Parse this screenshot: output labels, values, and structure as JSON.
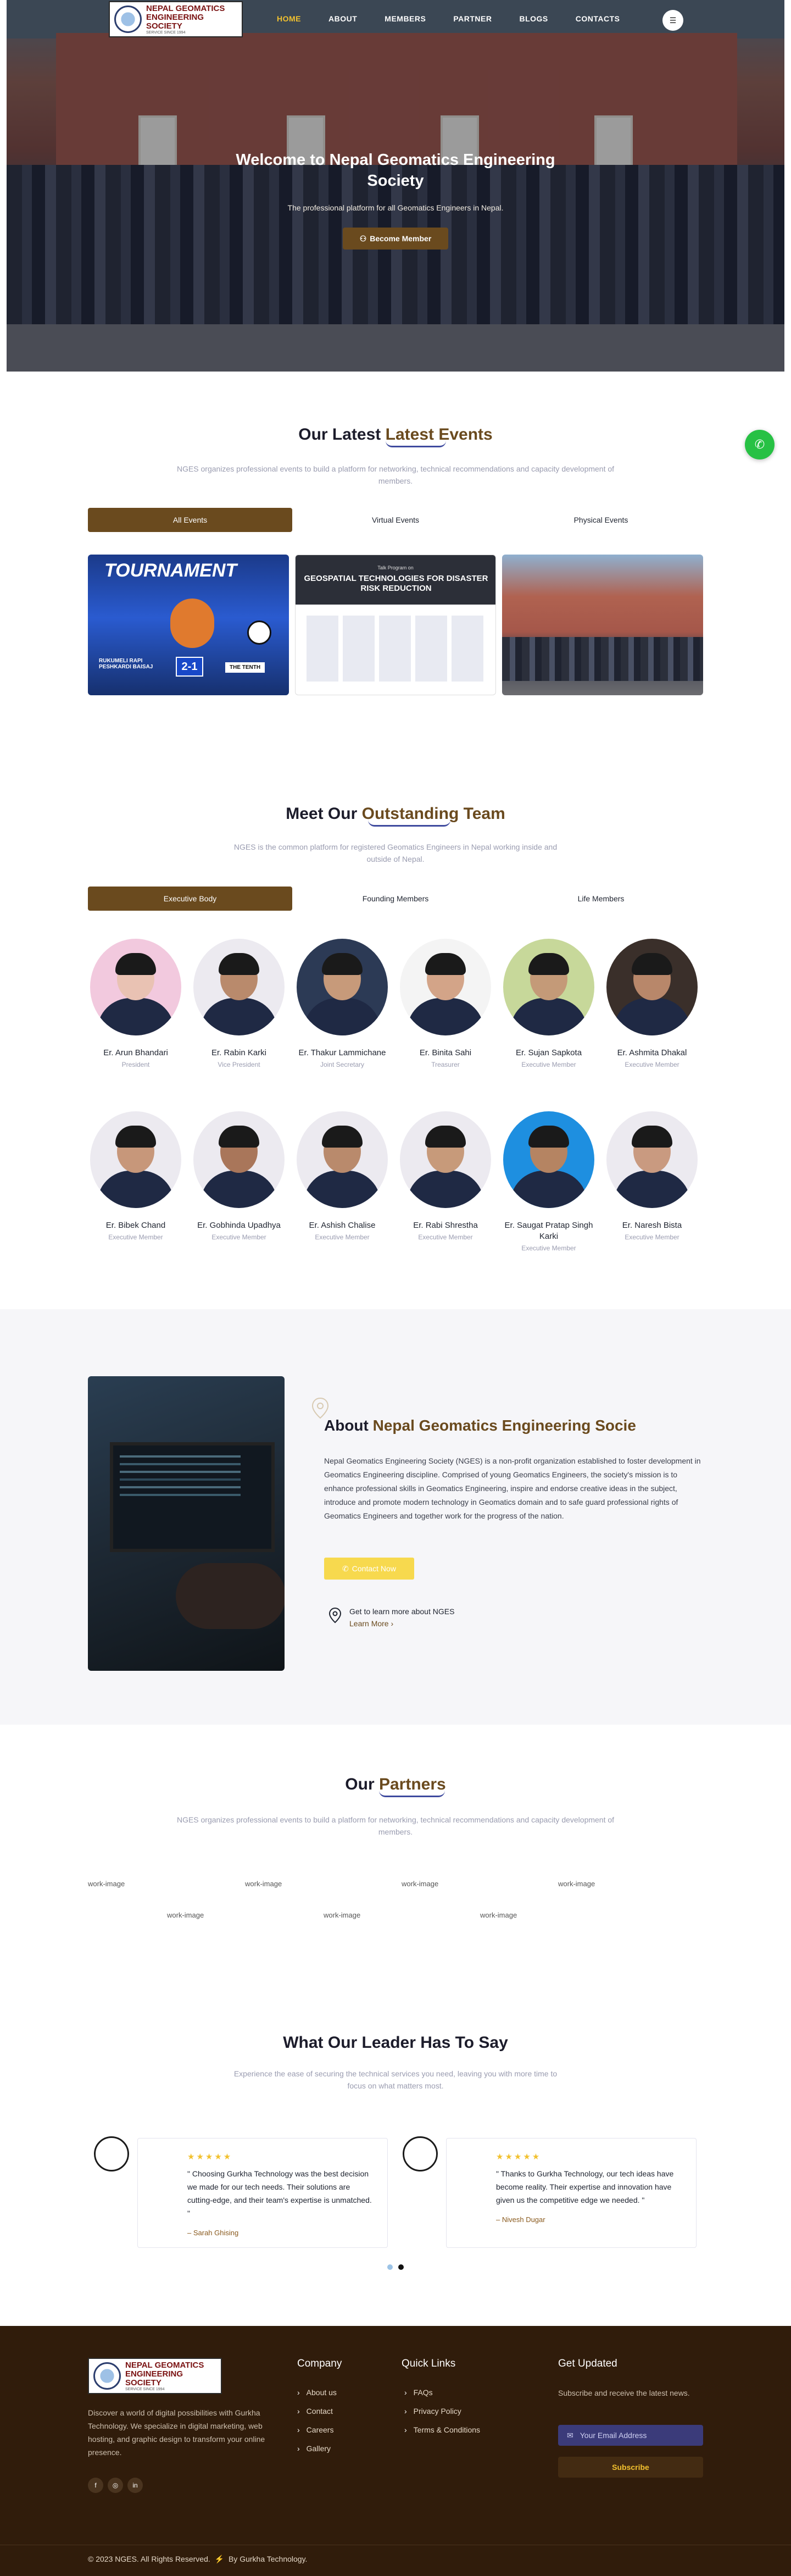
{
  "brand": {
    "name_line1": "NEPAL GEOMATICS",
    "name_line2": "ENGINEERING SOCIETY",
    "tagline": "SERVICE SINCE 1994"
  },
  "nav": {
    "items": [
      "HOME",
      "ABOUT",
      "MEMBERS",
      "PARTNER",
      "BLOGS",
      "CONTACTS"
    ],
    "active": "HOME"
  },
  "hero": {
    "title": "Welcome to Nepal Geomatics Engineering Society",
    "subtitle": "The professional platform for all Geomatics Engineers in Nepal.",
    "cta": "Become Member",
    "cta_icon": "user-icon"
  },
  "events": {
    "title_prefix": "Our Latest",
    "title_highlight": "Latest Events",
    "subtitle": "NGES organizes professional events to build a platform for networking, technical recommendations and capacity development of members.",
    "tabs": [
      "All Events",
      "Virtual Events",
      "Physical Events"
    ],
    "active_tab": "All Events",
    "cards": [
      {
        "poster_title": "TOURNAMENT",
        "score": "2-1",
        "team_a": "RUKUMELI RAPI PESHKARDI BAISAJ",
        "team_b": "THE TENTH"
      },
      {
        "header": "Talk Program on",
        "poster_title": "GEOSPATIAL TECHNOLOGIES FOR DISASTER RISK REDUCTION"
      },
      {
        "poster_title": ""
      }
    ]
  },
  "team": {
    "title_prefix": "Meet Our",
    "title_highlight": "Outstanding Team",
    "subtitle": "NGES is the common platform for registered Geomatics Engineers in Nepal working inside and outside of Nepal.",
    "tabs": [
      "Executive Body",
      "Founding Members",
      "Life Members"
    ],
    "active_tab": "Executive Body",
    "members": [
      {
        "name": "Er. Arun Bhandari",
        "role": "President"
      },
      {
        "name": "Er. Rabin Karki",
        "role": "Vice President"
      },
      {
        "name": "Er. Thakur Lammichane",
        "role": "Joint Secretary"
      },
      {
        "name": "Er. Binita Sahi",
        "role": "Treasurer"
      },
      {
        "name": "Er. Sujan Sapkota",
        "role": "Executive Member"
      },
      {
        "name": "Er. Ashmita Dhakal",
        "role": "Executive Member"
      },
      {
        "name": "Er. Bibek Chand",
        "role": "Executive Member"
      },
      {
        "name": "Er. Gobhinda Upadhya",
        "role": "Executive Member"
      },
      {
        "name": "Er. Ashish Chalise",
        "role": "Executive Member"
      },
      {
        "name": "Er. Rabi Shrestha",
        "role": "Executive Member"
      },
      {
        "name": "Er. Saugat Pratap Singh Karki",
        "role": "Executive Member"
      },
      {
        "name": "Er. Naresh Bista",
        "role": "Executive Member"
      }
    ]
  },
  "about": {
    "title_prefix": "About",
    "title_highlight": "Nepal Geomatics Engineering Socie",
    "body": "Nepal Geomatics Engineering Society (NGES) is a non-profit organization established to foster development in Geomatics Engineering discipline. Comprised of young Geomatics Engineers, the society's mission is to enhance professional skills in Geomatics Engineering, inspire and endorse creative ideas in the subject, introduce and promote modern technology in Geomatics domain and to safe guard professional rights of Geomatics Engineers and together work for the progress of the nation.",
    "cta": "Contact Now",
    "learn_label": "Get to learn more about NGES",
    "learn_link": "Learn More"
  },
  "partners": {
    "title_prefix": "Our",
    "title_highlight": "Partners",
    "subtitle": "NGES organizes professional events to build a platform for networking, technical recommendations and capacity development of members.",
    "items": [
      "work-image",
      "work-image",
      "work-image",
      "work-image",
      "work-image",
      "work-image",
      "work-image"
    ]
  },
  "testimonials": {
    "title": "What Our Leader Has To Say",
    "subtitle": "Experience the ease of securing the technical services you need, leaving you with more time to focus on what matters most.",
    "rating_stars": "★★★★★",
    "items": [
      {
        "quote": "\" Choosing Gurkha Technology was the best decision we made for our tech needs. Their solutions are cutting-edge, and their team's expertise is unmatched. \"",
        "author": "– Sarah Ghising"
      },
      {
        "quote": "\" Thanks to Gurkha Technology, our tech ideas have become reality. Their expertise and innovation have given us the competitive edge we needed. \"",
        "author": "– Nivesh Dugar"
      }
    ],
    "pager": {
      "count": 2,
      "active": 2
    }
  },
  "footer": {
    "about": "Discover a world of digital possibilities with Gurkha Technology. We specialize in digital marketing, web hosting, and graphic design to transform your online presence.",
    "social": [
      "facebook-icon",
      "instagram-icon",
      "linkedin-icon"
    ],
    "company": {
      "heading": "Company",
      "links": [
        "About us",
        "Contact",
        "Careers",
        "Gallery"
      ]
    },
    "quick": {
      "heading": "Quick Links",
      "links": [
        "FAQs",
        "Privacy Policy",
        "Terms & Conditions"
      ]
    },
    "updates": {
      "heading": "Get Updated",
      "text": "Subscribe and receive the latest news.",
      "placeholder": "Your Email Address",
      "button": "Subscribe"
    },
    "copyright": "© 2023 NGES. All Rights Reserved.",
    "credit": "By Gurkha Technology."
  },
  "colors": {
    "brand_brown": "#6a4a1e",
    "accent_gold": "#f2c12e",
    "footer_bg": "#301c0b",
    "whatsapp": "#27c144"
  }
}
